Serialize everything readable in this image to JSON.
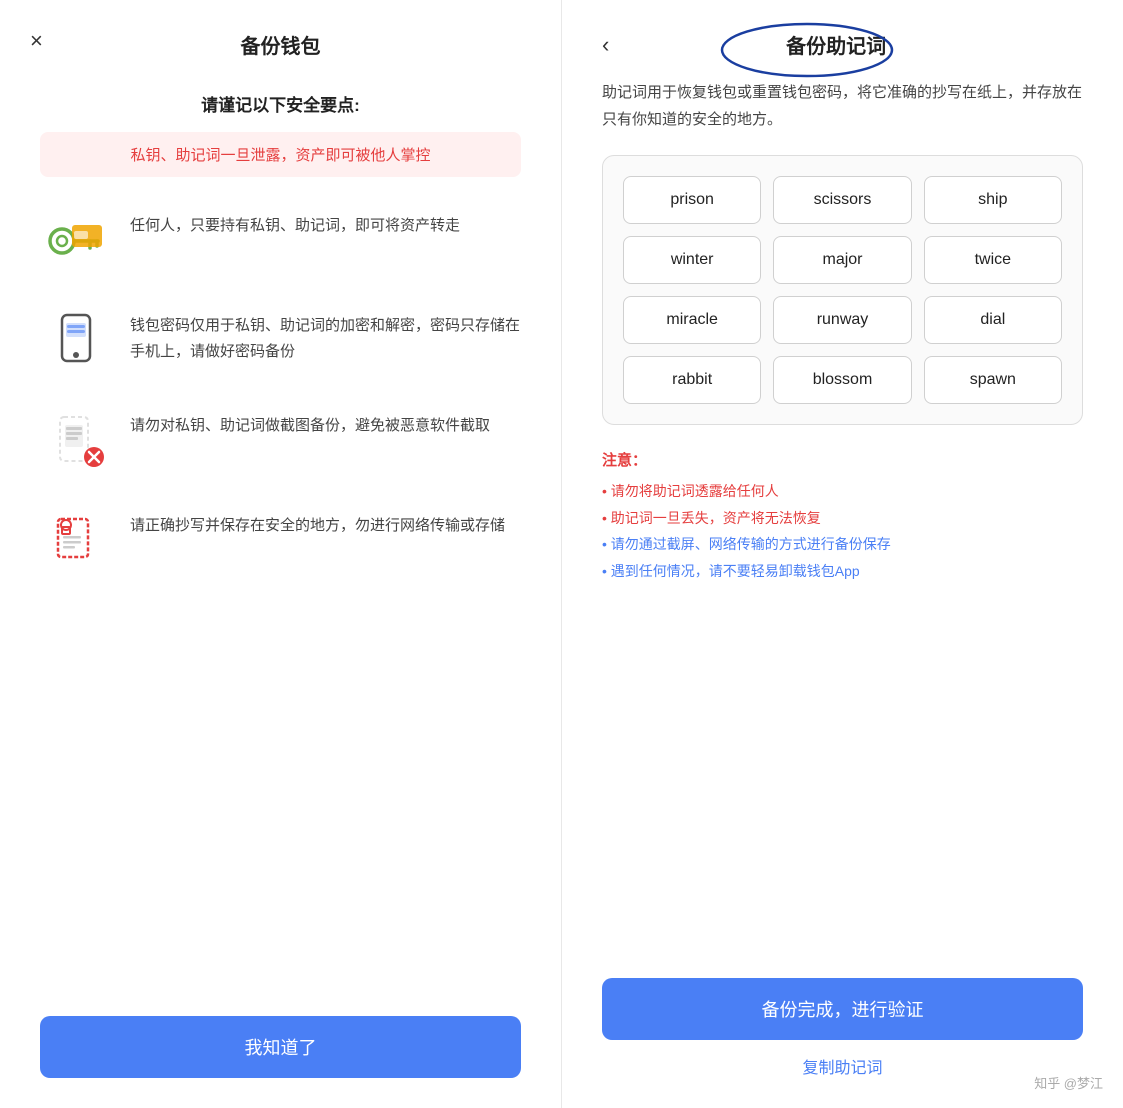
{
  "left": {
    "close_icon": "×",
    "title": "备份钱包",
    "subtitle": "请谨记以下安全要点:",
    "warning_text": "私钥、助记词一旦泄露，资产即可被他人掌控",
    "items": [
      {
        "icon": "🔑",
        "text": "任何人，只要持有私钥、助记词，即可将资产转走"
      },
      {
        "icon": "📱",
        "text": "钱包密码仅用于私钥、助记词的加密和解密，密码只存储在手机上，请做好密码备份"
      },
      {
        "icon": "📵",
        "text": "请勿对私钥、助记词做截图备份，避免被恶意软件截取"
      },
      {
        "icon": "📄",
        "text": "请正确抄写并保存在安全的地方，勿进行网络传输或存储"
      }
    ],
    "confirm_button": "我知道了"
  },
  "right": {
    "back_icon": "‹",
    "title": "备份助记词",
    "desc": "助记词用于恢复钱包或重置钱包密码，将它准确的抄写在纸上，并存放在只有你知道的安全的地方。",
    "mnemonic_words": [
      "prison",
      "scissors",
      "ship",
      "winter",
      "major",
      "twice",
      "miracle",
      "runway",
      "dial",
      "rabbit",
      "blossom",
      "spawn"
    ],
    "notice_title": "注意：",
    "notice_items": [
      {
        "text": "• 请勿将助记词透露给任何人",
        "color": "red"
      },
      {
        "text": "• 助记词一旦丢失，资产将无法恢复",
        "color": "red"
      },
      {
        "text": "• 请勿通过截屏、网络传输的方式进行备份保存",
        "color": "blue"
      },
      {
        "text": "• 遇到任何情况，请不要轻易卸载钱包App",
        "color": "blue"
      }
    ],
    "verify_button": "备份完成，进行验证",
    "copy_link": "复制助记词",
    "watermark": "知乎 @梦江"
  }
}
